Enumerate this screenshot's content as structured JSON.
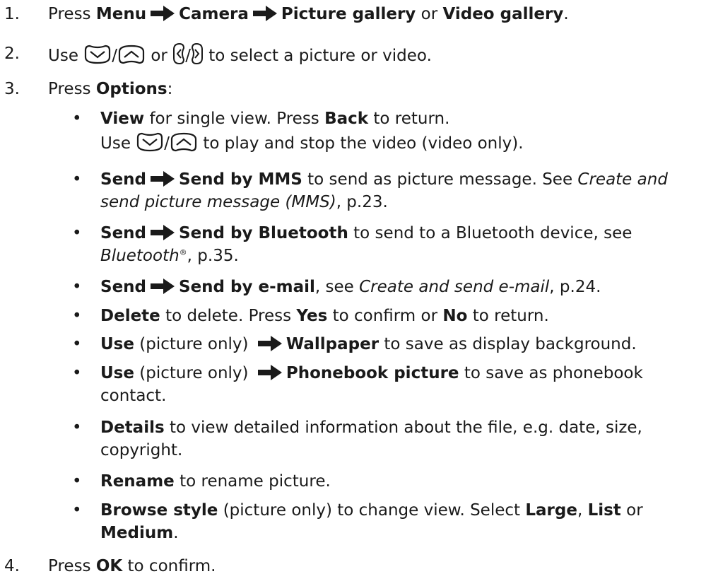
{
  "steps": [
    {
      "num": "1.",
      "parts": {
        "a": "Press ",
        "b1": "Menu",
        "b2": "Camera",
        "b3": "Picture gallery",
        "c": " or ",
        "b4": "Video gallery",
        "d": "."
      }
    },
    {
      "num": "2.",
      "parts": {
        "a": "Use ",
        "sep1": "/",
        "or": " or ",
        "sep2": "/",
        "d": " to select a picture or video."
      }
    },
    {
      "num": "3.",
      "parts": {
        "a": "Press ",
        "b1": "Options",
        "d": ":"
      }
    },
    {
      "num": "4.",
      "parts": {
        "a": "Press ",
        "b1": "OK",
        "d": " to confirm."
      }
    }
  ],
  "bullets": [
    {
      "b1": "View",
      "t1": " for single view. Press ",
      "b2": "Back",
      "t2": " to return.",
      "l2a": "Use ",
      "sep": "/",
      "l2b": " to play and stop the video (video only)."
    },
    {
      "b1": "Send",
      "b2": "Send by MMS",
      "t1": " to send as picture message. See ",
      "i1": "Create and send picture message (MMS)",
      "t2": ", p.23."
    },
    {
      "b1": "Send",
      "b2": "Send by Bluetooth",
      "t1": " to send to a Bluetooth device, see ",
      "i1": "Bluetooth",
      "sup": "®",
      "t2": ", p.35."
    },
    {
      "b1": "Send",
      "b2": "Send by e-mail",
      "t1": ", see ",
      "i1": "Create and send e-mail",
      "t2": ", p.24."
    },
    {
      "b1": "Delete",
      "t1": " to delete. Press ",
      "b2": "Yes",
      "t2": " to confirm or ",
      "b3": "No",
      "t3": " to return."
    },
    {
      "b1": "Use",
      "t1": " (picture only) ",
      "b2": "Wallpaper",
      "t2": " to save as display background."
    },
    {
      "b1": "Use",
      "t1": " (picture only) ",
      "b2": "Phonebook picture",
      "t2": " to save as phonebook contact."
    },
    {
      "b1": "Details",
      "t1": " to view detailed information about the file, e.g. date, size, copyright."
    },
    {
      "b1": "Rename",
      "t1": " to rename picture."
    },
    {
      "b1": "Browse style",
      "t1": " (picture only) to change view. Select ",
      "b2": "Large",
      "t2": ", ",
      "b3": "List",
      "t3": " or ",
      "b4": "Medium",
      "t4": "."
    }
  ],
  "bullet_char": "•",
  "icons": [
    "arrow-right-icon",
    "scroll-down-key-icon",
    "scroll-up-key-icon",
    "nav-left-key-icon",
    "nav-right-key-icon"
  ],
  "colors": {
    "text": "#1a1a1a",
    "background": "#ffffff"
  }
}
